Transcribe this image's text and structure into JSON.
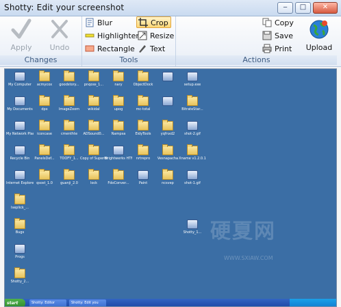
{
  "window": {
    "title": "Shotty: Edit your screenshot",
    "controls": {
      "minimize": "‒",
      "maximize": "□",
      "close": "✕"
    }
  },
  "ribbon": {
    "changes": {
      "label": "Changes",
      "apply_label": "Apply",
      "undo_label": "Undo"
    },
    "tools": {
      "label": "Tools",
      "blur_label": "Blur",
      "highlighter_label": "Highlighter",
      "rectangle_label": "Rectangle",
      "crop_label": "Crop",
      "resize_label": "Resize",
      "text_label": "Text",
      "selected_tool": "Crop"
    },
    "actions": {
      "label": "Actions",
      "copy_label": "Copy",
      "save_label": "Save",
      "print_label": "Print",
      "upload_label": "Upload"
    }
  },
  "desktop": {
    "icons": [
      {
        "cap": "My Computer",
        "kind": "app"
      },
      {
        "cap": "acmycox",
        "kind": "folder"
      },
      {
        "cap": "goodstory...",
        "kind": "folder"
      },
      {
        "cap": "pnqoss_1...",
        "kind": "folder"
      },
      {
        "cap": "nary",
        "kind": "folder"
      },
      {
        "cap": "ObjectDock",
        "kind": "folder"
      },
      {
        "cap": "",
        "kind": "app"
      },
      {
        "cap": "setup.exe",
        "kind": "app"
      },
      {
        "cap": "My Documents",
        "kind": "app"
      },
      {
        "cap": "dpx",
        "kind": "folder"
      },
      {
        "cap": "ImageZoom",
        "kind": "folder"
      },
      {
        "cap": "wikidal",
        "kind": "folder"
      },
      {
        "cap": "upog",
        "kind": "folder"
      },
      {
        "cap": "mc-total",
        "kind": "folder"
      },
      {
        "cap": "",
        "kind": "app"
      },
      {
        "cap": "BitrateStar...",
        "kind": "folder"
      },
      {
        "cap": "My Network Places",
        "kind": "app"
      },
      {
        "cap": "iconcase",
        "kind": "folder"
      },
      {
        "cap": "cmenthte",
        "kind": "folder"
      },
      {
        "cap": "ADSound0...",
        "kind": "folder"
      },
      {
        "cap": "Nampsa",
        "kind": "folder"
      },
      {
        "cap": "EidyTools",
        "kind": "folder"
      },
      {
        "cap": "yqfnxd2",
        "kind": "folder"
      },
      {
        "cap": "shot-2.gif",
        "kind": "app"
      },
      {
        "cap": "Recycle Bin",
        "kind": "app"
      },
      {
        "cap": "PanelsDef...",
        "kind": "folder"
      },
      {
        "cap": "TOOFY_1...",
        "kind": "folder"
      },
      {
        "cap": "Copy of Superbtore",
        "kind": "folder"
      },
      {
        "cap": "Brightwerks HTML Edi",
        "kind": "app"
      },
      {
        "cap": "nrtrepro",
        "kind": "folder"
      },
      {
        "cap": "Vesnapacha",
        "kind": "folder"
      },
      {
        "cap": "Xname v1.2.0.1",
        "kind": "folder"
      },
      {
        "cap": "Internet Explorer",
        "kind": "app"
      },
      {
        "cap": "qsost_1.0",
        "kind": "folder"
      },
      {
        "cap": "guanji_2.0",
        "kind": "folder"
      },
      {
        "cap": "lock",
        "kind": "folder"
      },
      {
        "cap": "FdoConver...",
        "kind": "folder"
      },
      {
        "cap": "Paint",
        "kind": "app"
      },
      {
        "cap": "ncsvep",
        "kind": "folder"
      },
      {
        "cap": "shot-1.gif",
        "kind": "app"
      },
      {
        "cap": "Iseplick_...",
        "kind": "folder"
      },
      {
        "cap": "Bugs",
        "kind": "folder"
      },
      {
        "cap": "Shotty_1...",
        "kind": "app"
      },
      {
        "cap": "Progs",
        "kind": "app"
      },
      {
        "cap": "Shotty_2...",
        "kind": "folder"
      }
    ],
    "watermark": "硬夏网",
    "watermark_url": "WWW.SXIAW.COM",
    "taskbar": {
      "start_label": "start",
      "items": [
        "Shotty: Editor",
        "Shotty: Edit you"
      ],
      "tray_time": ""
    }
  }
}
